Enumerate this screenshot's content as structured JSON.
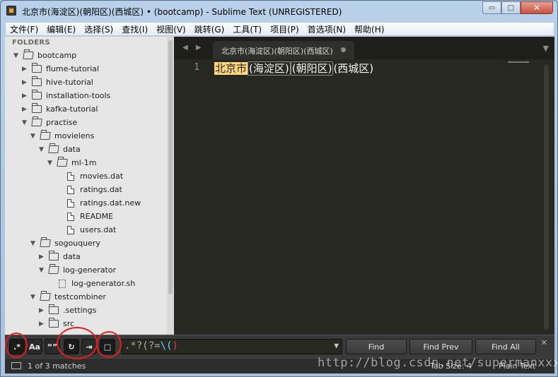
{
  "window": {
    "title": "北京市(海淀区)(朝阳区)(西城区) • (bootcamp) - Sublime Text (UNREGISTERED)",
    "minimize_glyph": "▭",
    "maximize_glyph": "□",
    "close_glyph": "✕"
  },
  "menu": [
    "文件(F)",
    "编辑(E)",
    "选择(S)",
    "查找(I)",
    "视图(V)",
    "跳转(G)",
    "工具(T)",
    "项目(P)",
    "首选项(N)",
    "帮助(H)"
  ],
  "sidebar": {
    "header": "FOLDERS",
    "items": [
      {
        "label": "bootcamp",
        "type": "folder",
        "expanded": true,
        "depth": 0
      },
      {
        "label": "flume-tutorial",
        "type": "folder",
        "expanded": false,
        "depth": 1
      },
      {
        "label": "hive-tutorial",
        "type": "folder",
        "expanded": false,
        "depth": 1
      },
      {
        "label": "installation-tools",
        "type": "folder",
        "expanded": false,
        "depth": 1
      },
      {
        "label": "kafka-tutorial",
        "type": "folder",
        "expanded": false,
        "depth": 1
      },
      {
        "label": "practise",
        "type": "folder",
        "expanded": true,
        "depth": 1
      },
      {
        "label": "movielens",
        "type": "folder",
        "expanded": true,
        "depth": 2
      },
      {
        "label": "data",
        "type": "folder",
        "expanded": true,
        "depth": 3
      },
      {
        "label": "ml-1m",
        "type": "folder",
        "expanded": true,
        "depth": 4
      },
      {
        "label": "movies.dat",
        "type": "file",
        "depth": 5
      },
      {
        "label": "ratings.dat",
        "type": "file",
        "depth": 5
      },
      {
        "label": "ratings.dat.new",
        "type": "file",
        "depth": 5
      },
      {
        "label": "README",
        "type": "file",
        "depth": 5
      },
      {
        "label": "users.dat",
        "type": "file",
        "depth": 5
      },
      {
        "label": "sogouquery",
        "type": "folder",
        "expanded": true,
        "depth": 2
      },
      {
        "label": "data",
        "type": "folder",
        "expanded": false,
        "depth": 3
      },
      {
        "label": "log-generator",
        "type": "folder",
        "expanded": true,
        "depth": 3
      },
      {
        "label": "log-generator.sh",
        "type": "script",
        "depth": 4
      },
      {
        "label": "testcombiner",
        "type": "folder",
        "expanded": true,
        "depth": 2
      },
      {
        "label": ".settings",
        "type": "folder",
        "expanded": false,
        "depth": 3
      },
      {
        "label": "src",
        "type": "folder",
        "expanded": false,
        "depth": 3
      }
    ]
  },
  "editor": {
    "tab_nav": "◀ ▶",
    "tab_label": "北京市(海淀区)(朝阳区)(西城区)",
    "tab_dropdown": "▼",
    "line_number": "1",
    "code_parts": [
      "北京市",
      "(海淀区)",
      "(朝阳区)",
      "(西城区)"
    ]
  },
  "findbar": {
    "regex_label": ".*",
    "case_label": "Aa",
    "word_label": "“”",
    "wrap_label": "↻",
    "selection_label": "⇥",
    "highlight_label": "□",
    "query_prefix": ".*?(?=",
    "query_escape": "\\(",
    "query_suffix": ")",
    "dropdown": "▼",
    "find_label": "Find",
    "find_prev_label": "Find Prev",
    "find_all_label": "Find All",
    "close": "✕"
  },
  "status": {
    "matches": "1 of 3 matches",
    "tab_size": "Tab Size: 4",
    "syntax": "Plain Text"
  },
  "watermark": "http://blog.csdn.net/supermanxxx",
  "colors": {
    "highlight_match": "#ffd580",
    "annotation_circle": "#e02020"
  }
}
